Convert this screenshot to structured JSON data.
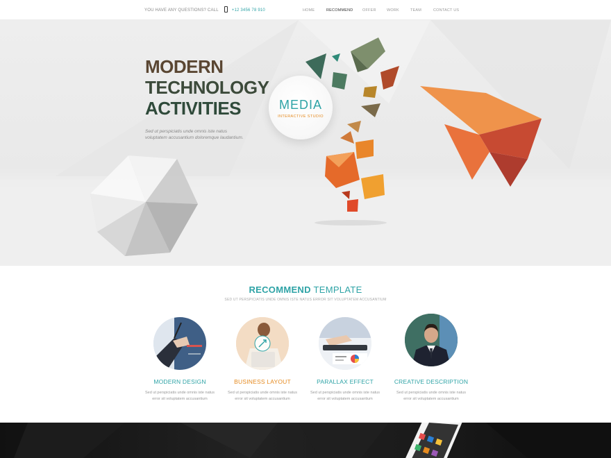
{
  "topbar": {
    "question_text": "YOU HAVE ANY QUESTIONS? CALL",
    "phone": "+12 3456 78 910",
    "nav": [
      "HOME",
      "RECOMMEND",
      "OFFER",
      "WORK",
      "TEAM",
      "CONTACT US"
    ],
    "active_nav": "RECOMMEND"
  },
  "hero": {
    "title_line1": "MODERN",
    "title_line2": "TECHNOLOGY",
    "title_line3": "ACTIVITIES",
    "description": "Sed ut perspiciatis unde omnis iste natus voluptatem accusantium doloremque laudantium.",
    "badge_title": "MEDIA",
    "badge_subtitle": "INTERACTIVE STUDIO"
  },
  "recommend": {
    "title_bold": "RECOMMEND",
    "title_light": " TEMPLATE",
    "subtitle": "SED UT PERSPICIATIS UNDE OMNIS ISTE NATUS ERROR SIT VOLUPTATEM ACCUSANTIUM",
    "features": [
      {
        "title": "MODERN DESIGN",
        "desc_line1": "Sed ut perspiciatis unde omnis iste natus",
        "desc_line2": "error sit voluptatem accusantium",
        "icon": "pen-hand-photo"
      },
      {
        "title_accent": "BUSINESS",
        "title_rest": " LAYOUT",
        "desc_line1": "Sed ut perspiciatis unde omnis iste natus",
        "desc_line2": "error sit voluptatem accusantium",
        "icon": "laptop-woman-photo"
      },
      {
        "title": "PARALLAX EFFECT",
        "desc_line1": "Sed ut perspiciatis unde omnis iste natus",
        "desc_line2": "error sit voluptatem accusantium",
        "icon": "tablet-hands-photo"
      },
      {
        "title": "CREATIVE DESCRIPTION",
        "desc_line1": "Sed ut perspiciatis unde omnis iste natus",
        "desc_line2": "error sit voluptatem accusantium",
        "icon": "businessman-photo"
      }
    ]
  },
  "colors": {
    "accent": "#2ea3a6",
    "orange": "#e58a1f",
    "dark_band": "#161616"
  }
}
